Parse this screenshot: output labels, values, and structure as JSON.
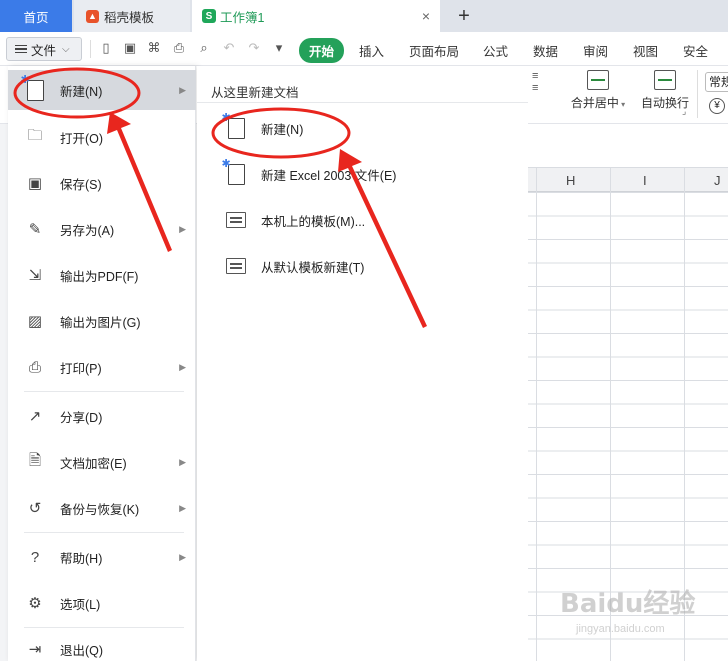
{
  "tabs": {
    "home": "首页",
    "docer": "稻壳模板",
    "workbook": "工作簿1",
    "plus": "+",
    "close": "×"
  },
  "ribbon": {
    "file_label": "文件",
    "tabs": [
      "开始",
      "插入",
      "页面布局",
      "公式",
      "数据",
      "审阅",
      "视图",
      "安全"
    ]
  },
  "toolbar": {
    "merge_center": "合并居中",
    "auto_wrap": "自动换行",
    "number_format": "常规",
    "yen": "¥"
  },
  "grid": {
    "columns": [
      "H",
      "I",
      "J"
    ]
  },
  "file_menu": {
    "items": [
      {
        "label": "新建(N)",
        "icon": "new-doc-icon",
        "arrow": true
      },
      {
        "label": "打开(O)",
        "icon": "folder-open-icon",
        "arrow": false
      },
      {
        "label": "保存(S)",
        "icon": "save-icon",
        "arrow": false
      },
      {
        "label": "另存为(A)",
        "icon": "save-as-icon",
        "arrow": true
      },
      {
        "label": "输出为PDF(F)",
        "icon": "export-pdf-icon",
        "arrow": false
      },
      {
        "label": "输出为图片(G)",
        "icon": "export-image-icon",
        "arrow": false
      },
      {
        "label": "打印(P)",
        "icon": "printer-icon",
        "arrow": true
      },
      {
        "label": "分享(D)",
        "icon": "share-icon",
        "arrow": false
      },
      {
        "label": "文档加密(E)",
        "icon": "encrypt-icon",
        "arrow": true
      },
      {
        "label": "备份与恢复(K)",
        "icon": "backup-icon",
        "arrow": true
      },
      {
        "label": "帮助(H)",
        "icon": "help-icon",
        "arrow": true
      },
      {
        "label": "选项(L)",
        "icon": "gear-icon",
        "arrow": false
      },
      {
        "label": "退出(Q)",
        "icon": "exit-icon",
        "arrow": false
      }
    ]
  },
  "submenu": {
    "title": "从这里新建文档",
    "items": [
      {
        "label": "新建(N)",
        "icon": "new-doc-icon"
      },
      {
        "label": "新建 Excel 2003 文件(E)",
        "icon": "new-doc-icon"
      },
      {
        "label": "本机上的模板(M)...",
        "icon": "template-icon"
      },
      {
        "label": "从默认模板新建(T)",
        "icon": "default-template-icon"
      }
    ]
  },
  "watermark": {
    "main": "Baidu经验",
    "sub": "jingyan.baidu.com"
  },
  "colors": {
    "accent": "#3b7be8",
    "start_tab": "#24a15a",
    "annotation": "#e8261e"
  }
}
